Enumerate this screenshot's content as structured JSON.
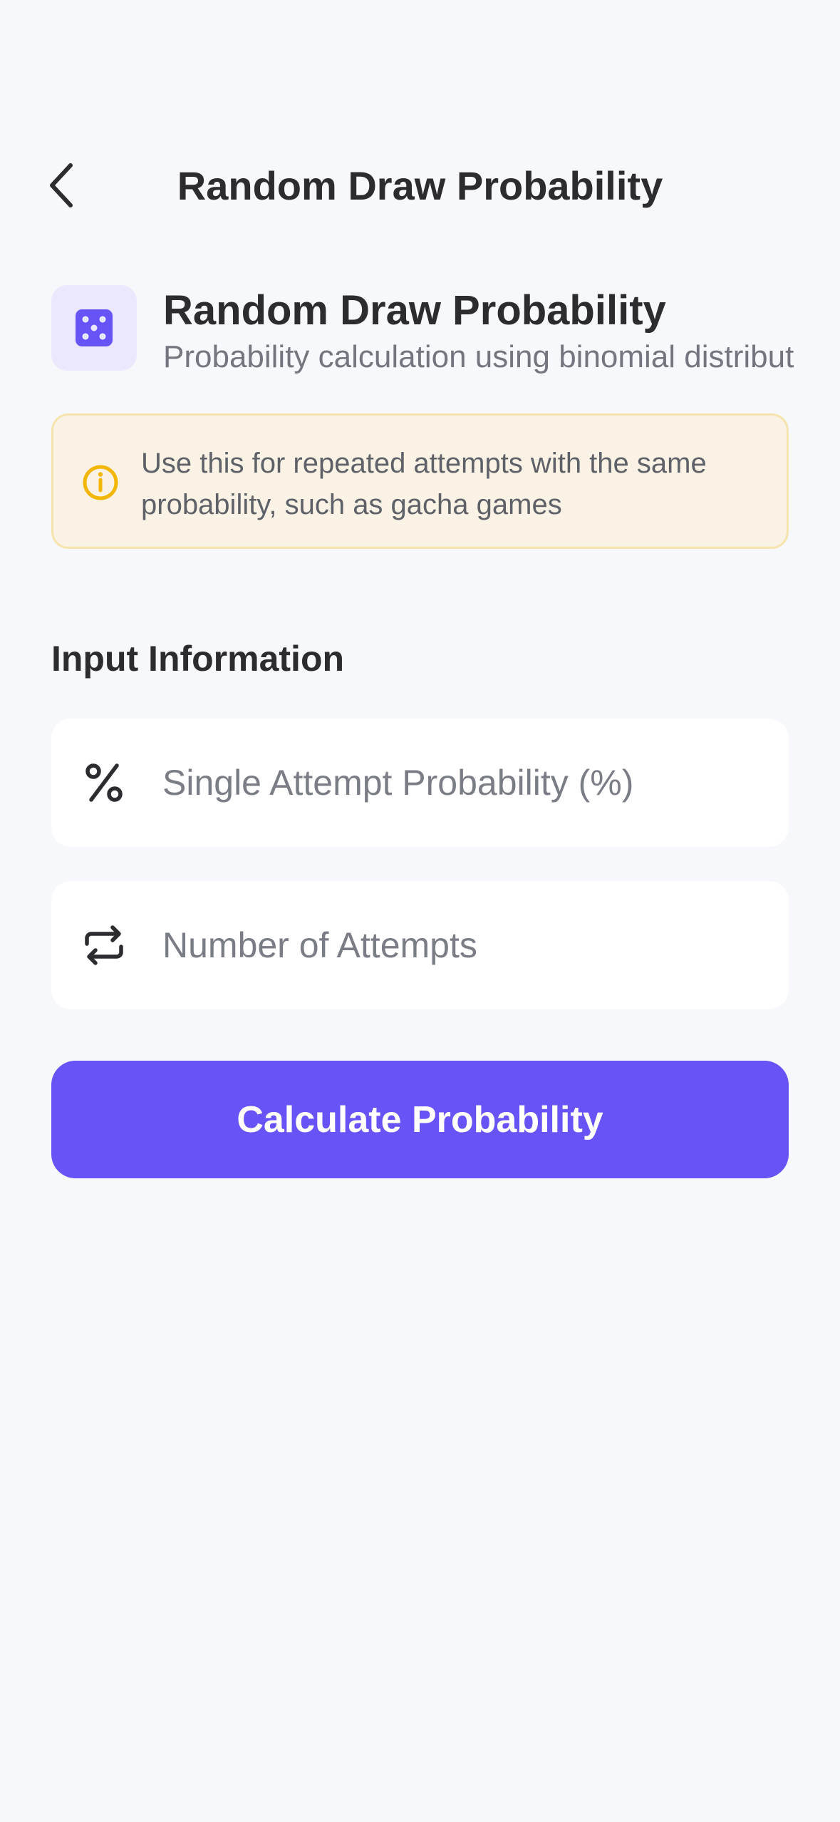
{
  "nav": {
    "title": "Random Draw Probability",
    "back_icon": "chevron-left-icon"
  },
  "header": {
    "icon": "dice-icon",
    "title": "Random Draw Probability",
    "subtitle": "Probability calculation using binomial distribut"
  },
  "banner": {
    "icon": "info-icon",
    "text": "Use this for repeated attempts with the same probability, such as gacha games"
  },
  "section": {
    "title": "Input Information"
  },
  "fields": {
    "probability": {
      "icon": "percent-icon",
      "placeholder": "Single Attempt Probability (%)",
      "value": ""
    },
    "attempts": {
      "icon": "repeat-icon",
      "placeholder": "Number of Attempts",
      "value": ""
    }
  },
  "button": {
    "label": "Calculate Probability"
  },
  "colors": {
    "background": "#f7f8fc",
    "accent": "#6853f7",
    "accent_soft": "#ebe8fd",
    "banner_bg": "#faf2e5",
    "banner_border": "#f5e4ad",
    "info": "#f2b705",
    "text_primary": "#2c2c30",
    "text_secondary": "#73767e"
  }
}
